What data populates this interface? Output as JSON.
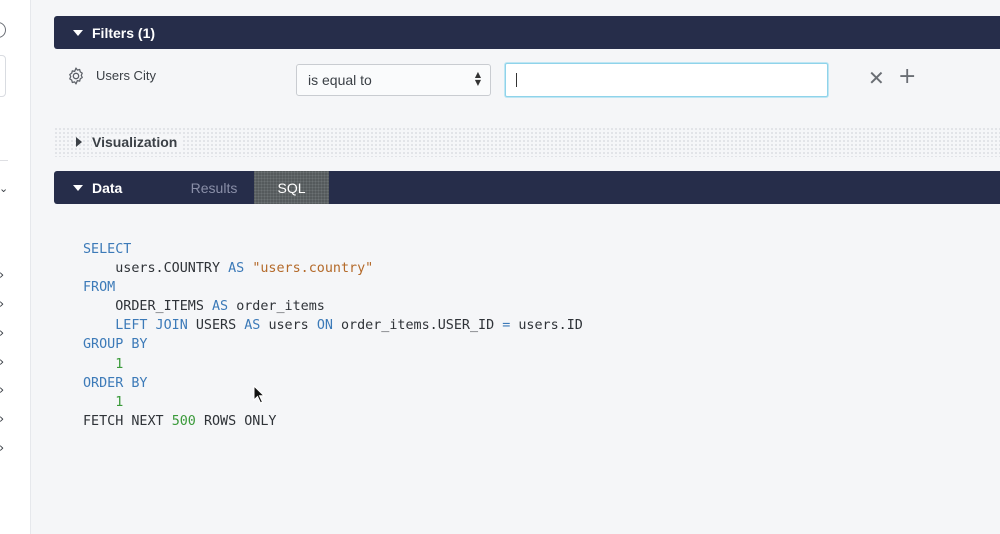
{
  "filters": {
    "title": "Filters (1)",
    "field_label": "Users City",
    "operator": "is equal to",
    "value": ""
  },
  "visualization": {
    "title": "Visualization"
  },
  "data": {
    "title": "Data",
    "tabs": [
      "Results",
      "SQL"
    ],
    "active_tab": "SQL"
  },
  "sql": {
    "select": "SELECT",
    "col_expr": "users.COUNTRY",
    "as1": "AS",
    "alias1": "\"users.country\"",
    "from": "FROM",
    "table1": "ORDER_ITEMS",
    "as2": "AS",
    "alias2": "order_items",
    "left_join": "LEFT JOIN",
    "table2": "USERS",
    "as3": "AS",
    "alias3": "users",
    "on": "ON",
    "join_left": "order_items.USER_ID",
    "eq": "=",
    "join_right": "users.ID",
    "group_by": "GROUP BY",
    "group_val": "1",
    "order_by": "ORDER BY",
    "order_val": "1",
    "fetch_next": "FETCH NEXT",
    "limit": "500",
    "rows_only": "ROWS ONLY"
  },
  "colors": {
    "bar_bg": "#262d4a",
    "keyword": "#3c7ab8",
    "string": "#b46a2a",
    "number": "#3a9a3a"
  }
}
